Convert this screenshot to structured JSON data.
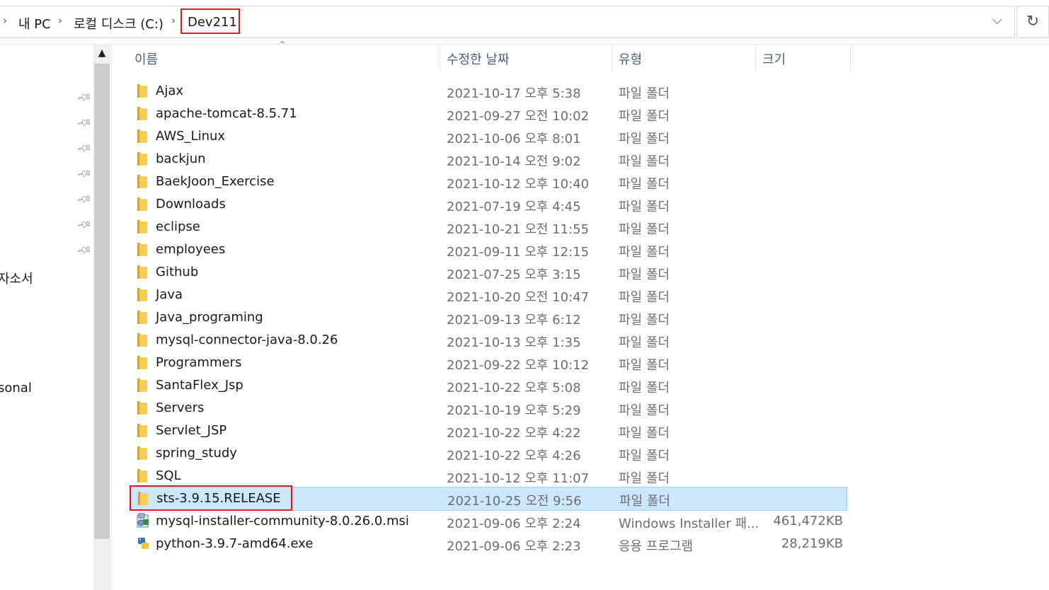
{
  "breadcrumb": {
    "items": [
      "내 PC",
      "로컬 디스크 (C:)",
      "Dev211"
    ]
  },
  "toolbar": {
    "dropdown_icon": "chevron-down-icon",
    "refresh_icon": "refresh-icon"
  },
  "nav_pane": {
    "partial_labels": [
      "자소서",
      "sonal"
    ],
    "pin_icon": "pin-icon"
  },
  "columns": {
    "name": "이름",
    "date": "수정한 날짜",
    "type": "유형",
    "size": "크기"
  },
  "files": [
    {
      "name": "Ajax",
      "date": "2021-10-17 오후 5:38",
      "type": "파일 폴더",
      "size": "",
      "icon": "folder-icon"
    },
    {
      "name": "apache-tomcat-8.5.71",
      "date": "2021-09-27 오전 10:02",
      "type": "파일 폴더",
      "size": "",
      "icon": "folder-icon"
    },
    {
      "name": "AWS_Linux",
      "date": "2021-10-06 오후 8:01",
      "type": "파일 폴더",
      "size": "",
      "icon": "folder-icon"
    },
    {
      "name": "backjun",
      "date": "2021-10-14 오전 9:02",
      "type": "파일 폴더",
      "size": "",
      "icon": "folder-icon"
    },
    {
      "name": "BaekJoon_Exercise",
      "date": "2021-10-12 오후 10:40",
      "type": "파일 폴더",
      "size": "",
      "icon": "folder-icon"
    },
    {
      "name": "Downloads",
      "date": "2021-07-19 오후 4:45",
      "type": "파일 폴더",
      "size": "",
      "icon": "folder-icon"
    },
    {
      "name": "eclipse",
      "date": "2021-10-21 오전 11:55",
      "type": "파일 폴더",
      "size": "",
      "icon": "folder-icon"
    },
    {
      "name": "employees",
      "date": "2021-09-11 오후 12:15",
      "type": "파일 폴더",
      "size": "",
      "icon": "folder-icon"
    },
    {
      "name": "Github",
      "date": "2021-07-25 오후 3:15",
      "type": "파일 폴더",
      "size": "",
      "icon": "folder-icon"
    },
    {
      "name": "Java",
      "date": "2021-10-20 오전 10:47",
      "type": "파일 폴더",
      "size": "",
      "icon": "folder-icon"
    },
    {
      "name": "Java_programing",
      "date": "2021-09-13 오후 6:12",
      "type": "파일 폴더",
      "size": "",
      "icon": "folder-icon"
    },
    {
      "name": "mysql-connector-java-8.0.26",
      "date": "2021-10-13 오후 1:35",
      "type": "파일 폴더",
      "size": "",
      "icon": "folder-icon"
    },
    {
      "name": "Programmers",
      "date": "2021-09-22 오후 10:12",
      "type": "파일 폴더",
      "size": "",
      "icon": "folder-icon"
    },
    {
      "name": "SantaFlex_Jsp",
      "date": "2021-10-22 오후 5:08",
      "type": "파일 폴더",
      "size": "",
      "icon": "folder-icon"
    },
    {
      "name": "Servers",
      "date": "2021-10-19 오후 5:29",
      "type": "파일 폴더",
      "size": "",
      "icon": "folder-icon"
    },
    {
      "name": "Servlet_JSP",
      "date": "2021-10-22 오후 4:22",
      "type": "파일 폴더",
      "size": "",
      "icon": "folder-icon"
    },
    {
      "name": "spring_study",
      "date": "2021-10-22 오후 4:26",
      "type": "파일 폴더",
      "size": "",
      "icon": "folder-icon"
    },
    {
      "name": "SQL",
      "date": "2021-10-12 오후 11:07",
      "type": "파일 폴더",
      "size": "",
      "icon": "folder-icon"
    },
    {
      "name": "sts-3.9.15.RELEASE",
      "date": "2021-10-25 오전 9:56",
      "type": "파일 폴더",
      "size": "",
      "icon": "folder-icon",
      "selected": true
    },
    {
      "name": "mysql-installer-community-8.0.26.0.msi",
      "date": "2021-09-06 오후 2:24",
      "type": "Windows Installer 패...",
      "size": "461,472KB",
      "icon": "msi-installer-icon"
    },
    {
      "name": "python-3.9.7-amd64.exe",
      "date": "2021-09-06 오후 2:23",
      "type": "응용 프로그램",
      "size": "28,219KB",
      "icon": "exe-app-icon"
    }
  ],
  "colors": {
    "highlight": "#e0191e",
    "selection": "#cce8ff",
    "header_text": "#4c607a"
  }
}
